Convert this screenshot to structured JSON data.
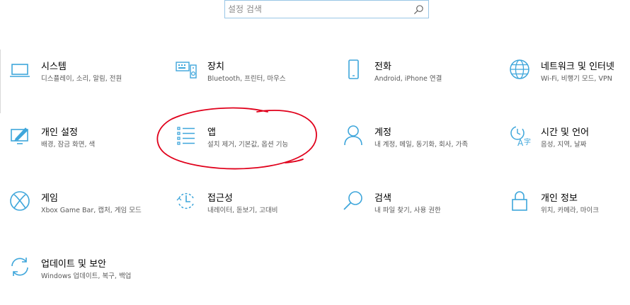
{
  "search": {
    "placeholder": "설정 검색"
  },
  "tiles": [
    {
      "title": "시스템",
      "desc": "디스플레이, 소리, 알림, 전원",
      "icon": "laptop-icon"
    },
    {
      "title": "장치",
      "desc": "Bluetooth, 프린터, 마우스",
      "icon": "keyboard-speaker-icon"
    },
    {
      "title": "전화",
      "desc": "Android, iPhone 연결",
      "icon": "phone-icon"
    },
    {
      "title": "네트워크 및 인터넷",
      "desc": "Wi-Fi, 비행기 모드, VPN",
      "icon": "globe-icon"
    },
    {
      "title": "개인 설정",
      "desc": "배경, 잠금 화면, 색",
      "icon": "paint-screen-icon"
    },
    {
      "title": "앱",
      "desc": "설치 제거, 기본값, 옵션 기능",
      "icon": "app-list-icon"
    },
    {
      "title": "계정",
      "desc": "내 계정, 메일, 동기화, 회사, 가족",
      "icon": "person-icon"
    },
    {
      "title": "시간 및 언어",
      "desc": "음성, 지역, 날짜",
      "icon": "language-time-icon"
    },
    {
      "title": "게임",
      "desc": "Xbox Game Bar, 캡처, 게임 모드",
      "icon": "xbox-icon"
    },
    {
      "title": "접근성",
      "desc": "내레이터, 돋보기, 고대비",
      "icon": "ease-of-access-icon"
    },
    {
      "title": "검색",
      "desc": "내 파일 찾기, 사용 권한",
      "icon": "search-icon"
    },
    {
      "title": "개인 정보",
      "desc": "위치, 카메라, 마이크",
      "icon": "lock-icon"
    },
    {
      "title": "업데이트 및 보안",
      "desc": "Windows 업데이트, 복구, 백업",
      "icon": "sync-icon"
    }
  ],
  "colors": {
    "accent": "#0078d7",
    "icon": "#3ea6db",
    "annotation": "#e0001b"
  }
}
